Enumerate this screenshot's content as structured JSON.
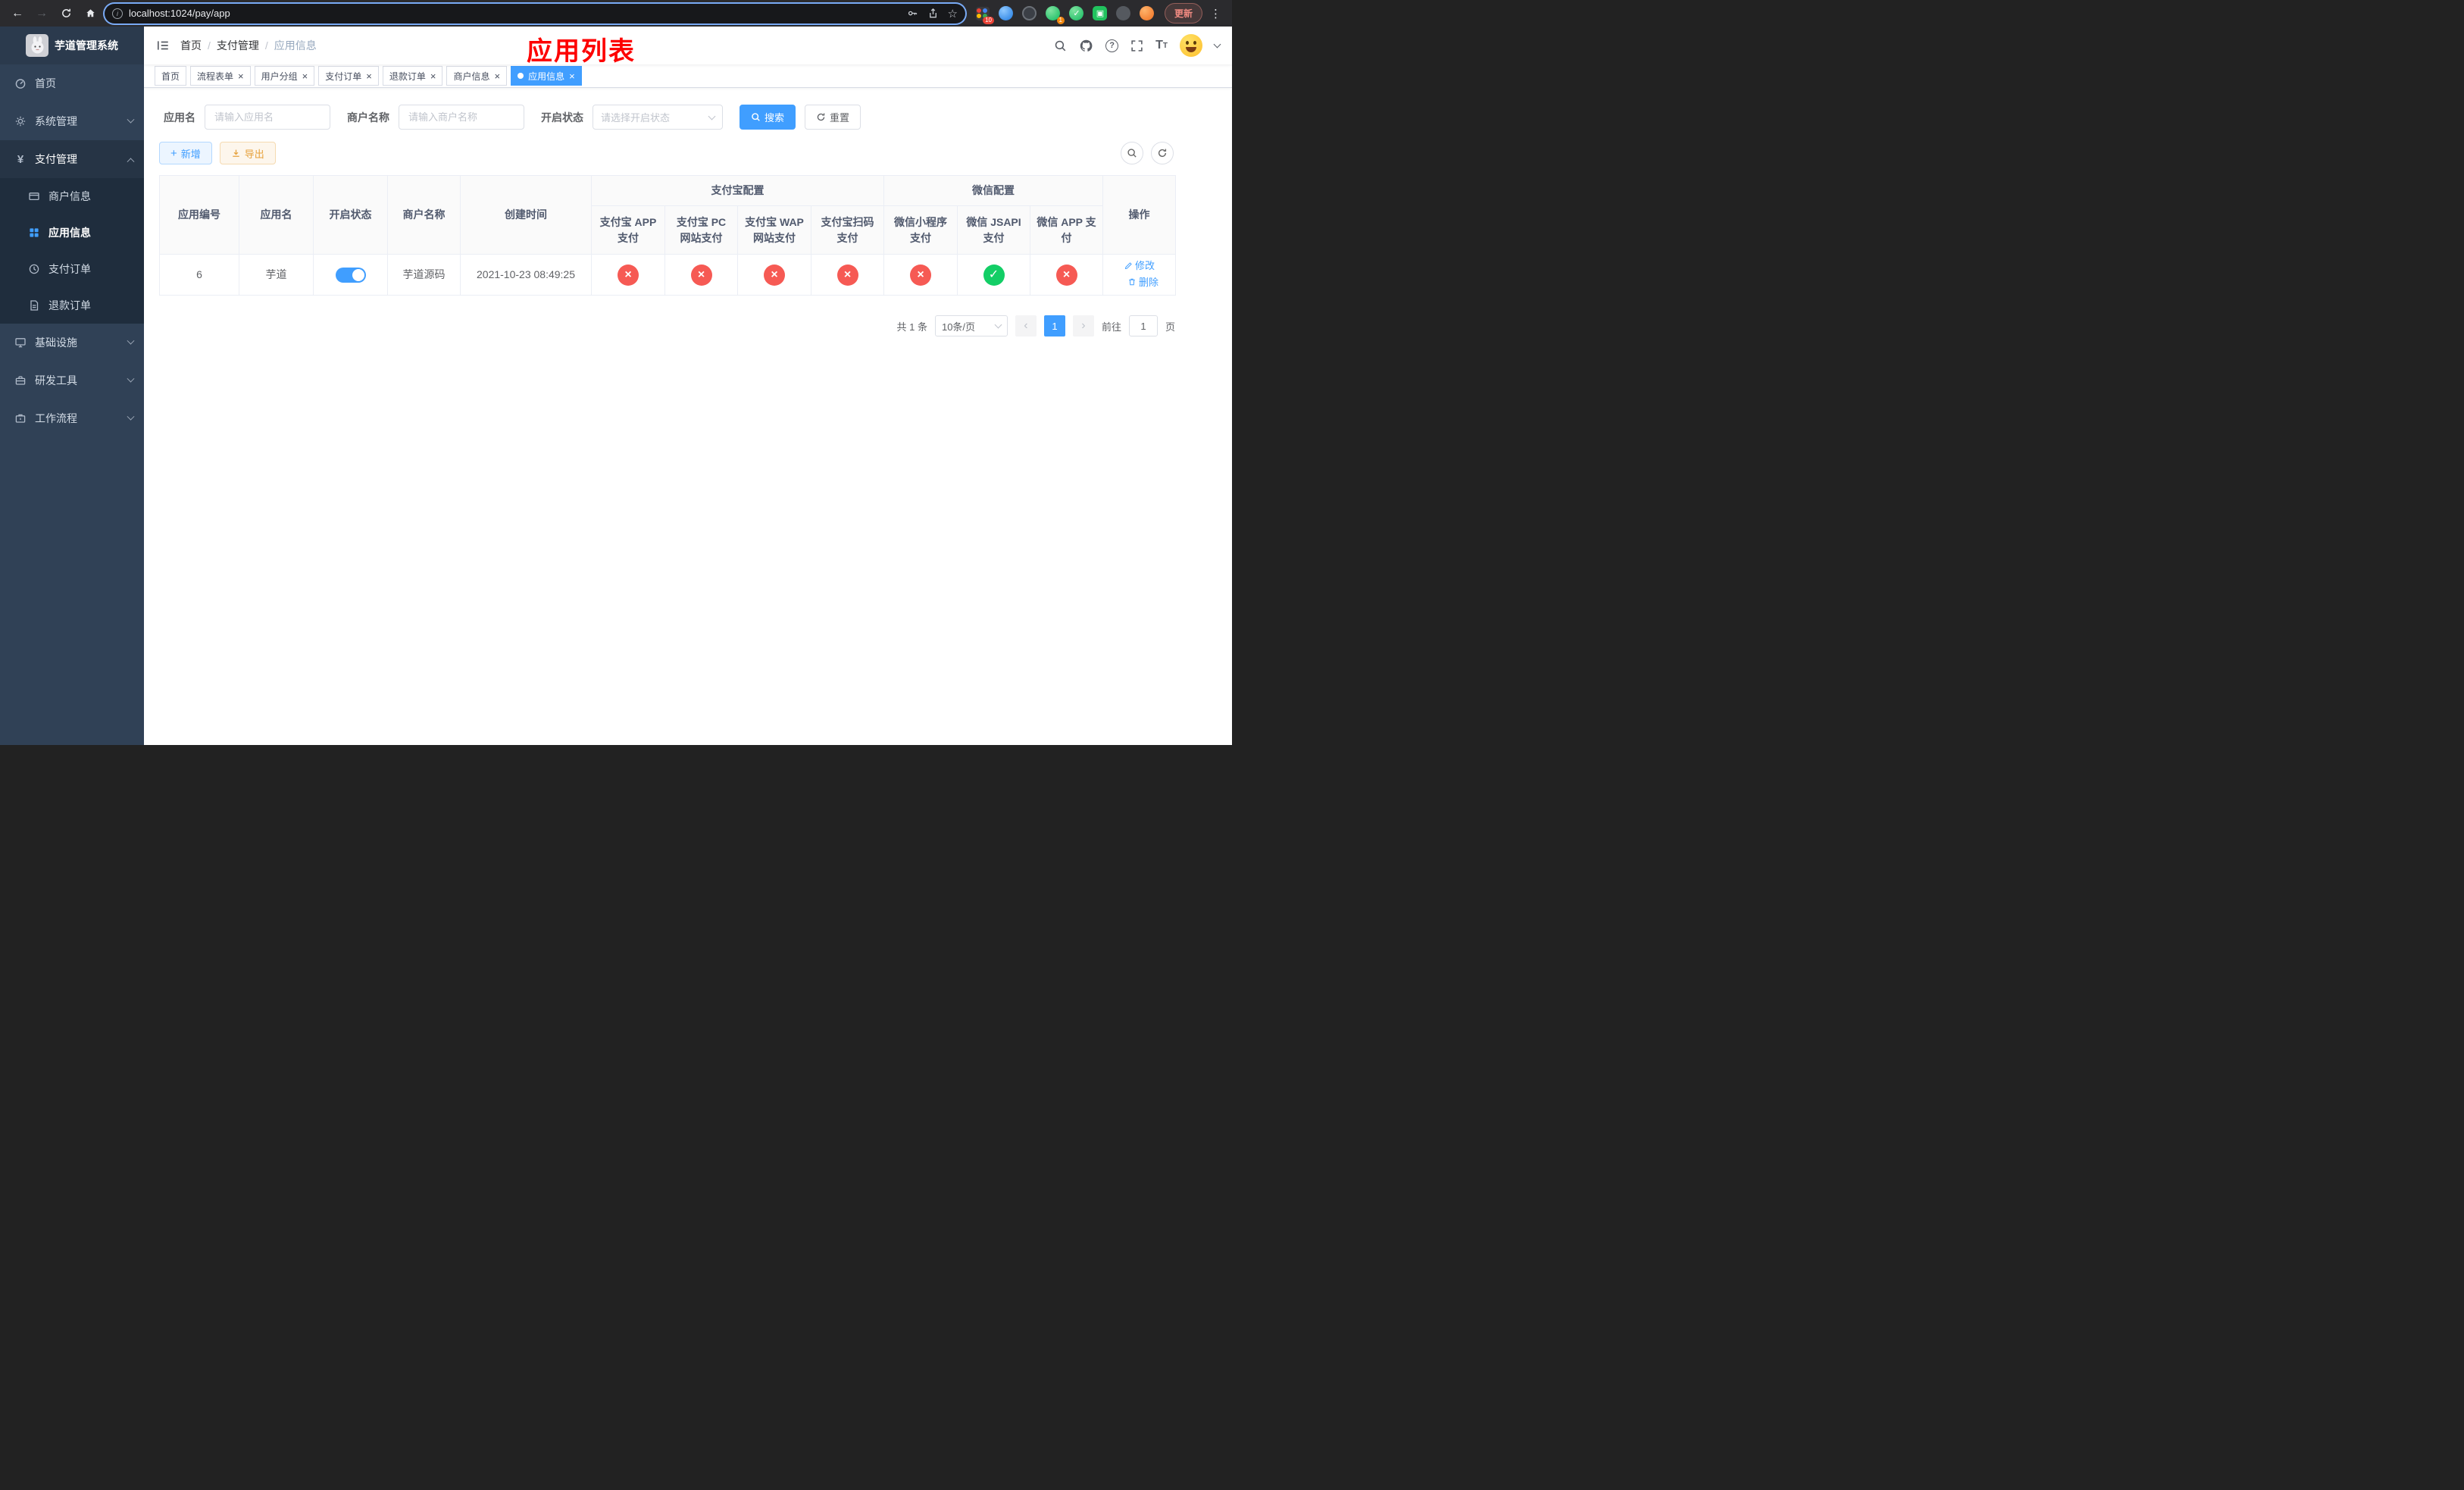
{
  "colors": {
    "accent": "#409eff",
    "danger": "#f65a54",
    "success": "#13ce66",
    "warning": "#e6a23c",
    "sidebar_bg": "#304156",
    "annotation_red": "#fd0000"
  },
  "browser": {
    "url": "localhost:1024/pay/app",
    "update_label": "更新",
    "ext_badges": {
      "first": "10",
      "second": "1"
    }
  },
  "sidebar": {
    "title": "芋道管理系统",
    "items": [
      {
        "label": "首页"
      },
      {
        "label": "系统管理"
      },
      {
        "label": "支付管理"
      },
      {
        "label": "基础设施"
      },
      {
        "label": "研发工具"
      },
      {
        "label": "工作流程"
      }
    ],
    "submenu": [
      {
        "label": "商户信息"
      },
      {
        "label": "应用信息"
      },
      {
        "label": "支付订单"
      },
      {
        "label": "退款订单"
      }
    ]
  },
  "navbar": {
    "breadcrumb": [
      "首页",
      "支付管理",
      "应用信息"
    ],
    "annotation": "应用列表"
  },
  "tabs": [
    {
      "label": "首页"
    },
    {
      "label": "流程表单"
    },
    {
      "label": "用户分组"
    },
    {
      "label": "支付订单"
    },
    {
      "label": "退款订单"
    },
    {
      "label": "商户信息"
    },
    {
      "label": "应用信息"
    }
  ],
  "filters": {
    "app_name_label": "应用名",
    "app_name_placeholder": "请输入应用名",
    "merchant_label": "商户名称",
    "merchant_placeholder": "请输入商户名称",
    "status_label": "开启状态",
    "status_placeholder": "请选择开启状态",
    "search_label": "搜索",
    "reset_label": "重置"
  },
  "toolbar": {
    "add": "新增",
    "export": "导出"
  },
  "table": {
    "headers": {
      "app_id": "应用编号",
      "app_name": "应用名",
      "status": "开启状态",
      "merchant": "商户名称",
      "created": "创建时间",
      "alipay_group": "支付宝配置",
      "wechat_group": "微信配置",
      "actions": "操作",
      "alipay_app": "支付宝 APP 支付",
      "alipay_pc": "支付宝 PC 网站支付",
      "alipay_wap": "支付宝 WAP 网站支付",
      "alipay_qr": "支付宝扫码支付",
      "wx_mini": "微信小程序支付",
      "wx_jsapi": "微信 JSAPI 支付",
      "wx_app": "微信 APP 支付"
    },
    "row": {
      "id": "6",
      "name": "芋道",
      "switch_on": "true",
      "merchant": "芋道源码",
      "created": "2021-10-23 08:49:25",
      "statuses": [
        "error",
        "error",
        "error",
        "error",
        "error",
        "success",
        "error"
      ],
      "modify": "修改",
      "delete": "删除"
    }
  },
  "pagination": {
    "total": "共 1 条",
    "page_size": "10条/页",
    "page": "1",
    "goto_label": "前往",
    "goto_value": "1",
    "unit": "页"
  }
}
